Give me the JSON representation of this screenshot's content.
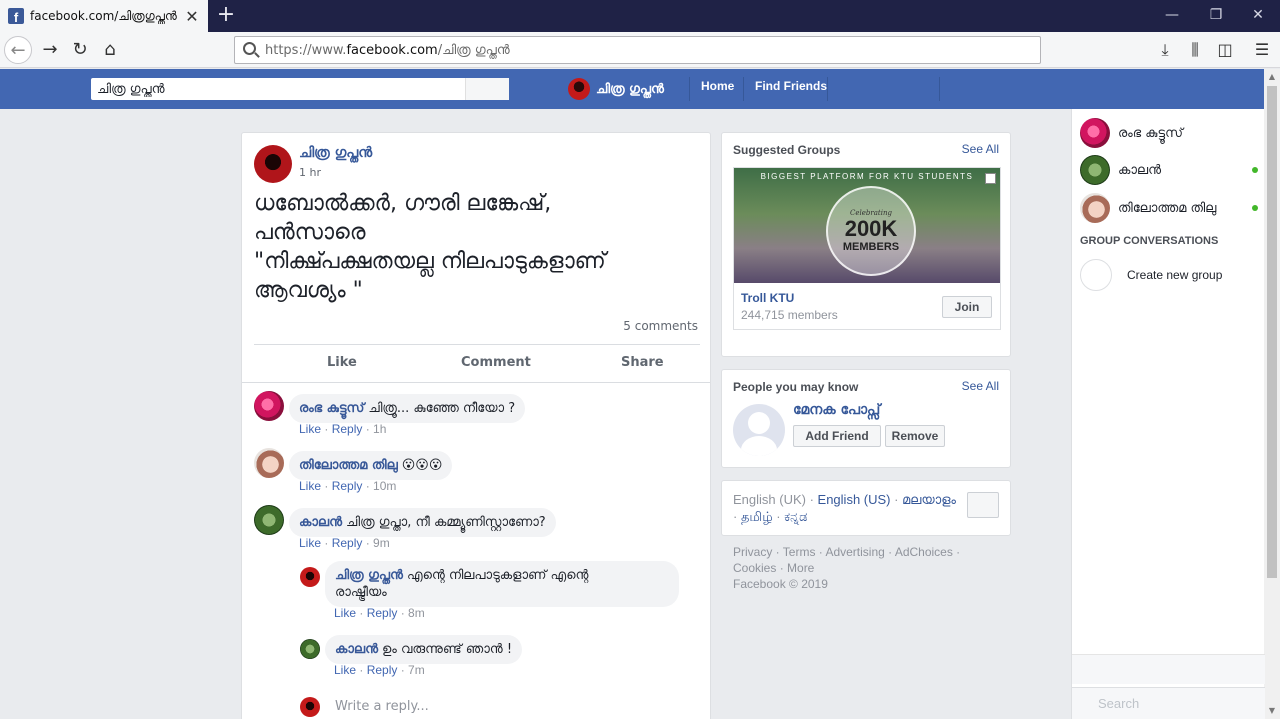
{
  "browser": {
    "tab_title": "facebook.com/ചിത്രഗുപ്തൻ",
    "tab_close": "✕",
    "new_tab": "+",
    "url_prefix": "https://www.",
    "url_domain": "facebook.com",
    "url_path": "/ചിത്ര ഗുപ്തൻ",
    "win_min": "—",
    "win_restore": "❐",
    "win_close": "✕"
  },
  "fb_header": {
    "search_value": "ചിത്ര ഗുപ്തൻ",
    "profile_name": "ചിത്ര ഗുപ്തൻ",
    "home": "Home",
    "find_friends": "Find Friends"
  },
  "post": {
    "author": "ചിത്ര ഗുപ്തൻ",
    "time": "1 hr",
    "text_line1": "ധബോൽക്കർ, ഗൗരി ലങ്കേഷ്,",
    "text_line2": "പൻസാരെ",
    "text_line3": "\"നിക്ഷ്പക്ഷതയല്ല നിലപാടുകളാണ്",
    "text_line4": "ആവശ്യം \"",
    "comments_count": "5 comments",
    "actions": {
      "like": "Like",
      "comment": "Comment",
      "share": "Share"
    }
  },
  "comments": [
    {
      "name": "രംഭ കുട്ടൂസ്",
      "text": "ചിത്രൂ... കുഞ്ഞേ നീയോ ?",
      "like": "Like",
      "reply": "Reply",
      "time": "1h"
    },
    {
      "name": "തിലോത്തമ തിലു",
      "text": "😮😮😮",
      "like": "Like",
      "reply": "Reply",
      "time": "10m"
    },
    {
      "name": "കാലൻ",
      "text": "ചിത്ര ഗുപ്താ, നീ കമ്മ്യൂണിസ്റ്റാണോ?",
      "like": "Like",
      "reply": "Reply",
      "time": "9m"
    }
  ],
  "replies": [
    {
      "name": "ചിത്ര ഗുപ്തൻ",
      "text_line1": "എന്റെ നിലപാടുകളാണ് എന്റെ",
      "text_line2": "രാഷ്ട്രീയം",
      "like": "Like",
      "reply": "Reply",
      "time": "8m"
    },
    {
      "name": "കാലൻ",
      "text": "ഉം വരുന്നുണ്ട് ഞാൻ !",
      "like": "Like",
      "reply": "Reply",
      "time": "7m"
    }
  ],
  "reply_placeholder": "Write a reply...",
  "suggested_groups": {
    "title": "Suggested Groups",
    "see_all": "See All",
    "image_tagline": "BIGGEST PLATFORM FOR KTU STUDENTS",
    "image_celebrating": "Celebrating",
    "image_count": "200K",
    "image_members": "MEMBERS",
    "group_name": "Troll KTU",
    "group_members": "244,715 members",
    "join": "Join"
  },
  "people_you_may_know": {
    "title": "People you may know",
    "see_all": "See All",
    "name": "മേനക പോപ്സ്",
    "add_friend": "Add Friend",
    "remove": "Remove"
  },
  "languages": {
    "current": "English (UK)",
    "sep": " · ",
    "others": [
      "English (US)",
      "മലയാളം",
      "தமிழ்",
      "ಕನ್ನಡ"
    ]
  },
  "footer": {
    "line1": "Privacy · Terms · Advertising · AdChoices ·",
    "line2": "Cookies · More",
    "line3": "Facebook © 2019"
  },
  "chat": {
    "contacts": [
      {
        "name": "രംഭ കുട്ടൂസ്",
        "online": false
      },
      {
        "name": "കാലൻ",
        "online": true
      },
      {
        "name": "തിലോത്തമ തിലു",
        "online": true
      }
    ],
    "group_conversations": "GROUP CONVERSATIONS",
    "create_group": "Create new group",
    "search_placeholder": "Search"
  },
  "colors": {
    "fb_blue": "#4267b2",
    "link_blue": "#365899",
    "online_green": "#42b72a",
    "tabbar": "#1f2246"
  }
}
